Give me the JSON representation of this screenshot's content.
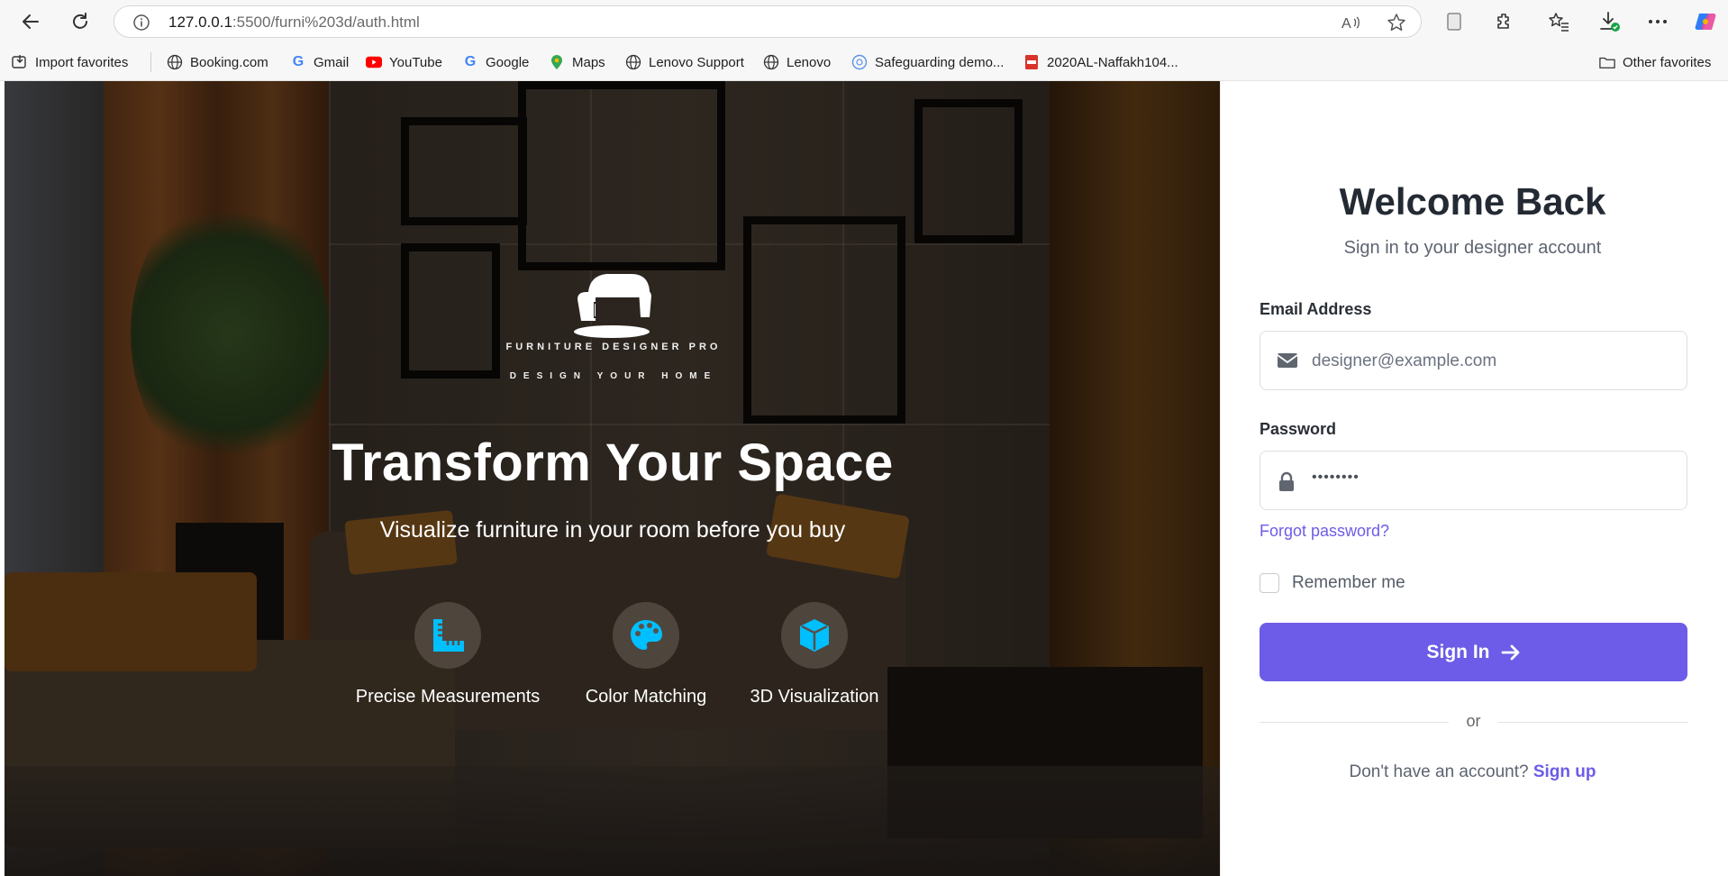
{
  "browser": {
    "url_host": "127.0.0.1",
    "url_rest": ":5500/furni%203d/auth.html",
    "bookmarks": [
      {
        "label": "Import favorites",
        "icon": "import-icon"
      },
      {
        "label": "Booking.com",
        "icon": "globe-icon"
      },
      {
        "label": "Gmail",
        "icon": "google-icon"
      },
      {
        "label": "YouTube",
        "icon": "youtube-icon"
      },
      {
        "label": "Google",
        "icon": "google-icon"
      },
      {
        "label": "Maps",
        "icon": "maps-icon"
      },
      {
        "label": "Lenovo Support",
        "icon": "globe-icon"
      },
      {
        "label": "Lenovo",
        "icon": "globe-icon"
      },
      {
        "label": "Safeguarding demo...",
        "icon": "un-icon"
      },
      {
        "label": "2020AL-Naffakh104...",
        "icon": "pdf-icon"
      }
    ],
    "other_favorites": "Other favorites"
  },
  "hero": {
    "brand_name": "FURNITURE DESIGNER PRO",
    "brand_tagline": "DESIGN YOUR HOME",
    "title": "Transform Your Space",
    "subtitle": "Visualize furniture in your room before you buy",
    "features": [
      {
        "label": "Precise Measurements",
        "icon": "ruler-icon"
      },
      {
        "label": "Color Matching",
        "icon": "palette-icon"
      },
      {
        "label": "3D Visualization",
        "icon": "cube-icon"
      }
    ],
    "accent_color": "#00bfff"
  },
  "form": {
    "title": "Welcome Back",
    "subtitle": "Sign in to your designer account",
    "email_label": "Email Address",
    "email_placeholder": "designer@example.com",
    "password_label": "Password",
    "password_value": "••••••••",
    "forgot": "Forgot password?",
    "remember": "Remember me",
    "signin": "Sign In",
    "or": "or",
    "signup_prompt": "Don't have an account?",
    "signup_link": "Sign up",
    "primary_color": "#6c5ce7"
  }
}
